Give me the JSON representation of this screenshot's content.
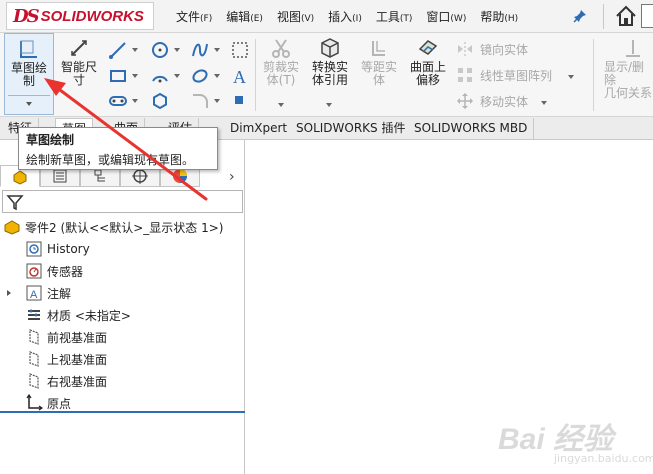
{
  "app": {
    "logo_text": "SOLIDWORKS"
  },
  "menu": [
    {
      "label": "文件",
      "key": "(F)"
    },
    {
      "label": "编辑",
      "key": "(E)"
    },
    {
      "label": "视图",
      "key": "(V)"
    },
    {
      "label": "插入",
      "key": "(I)"
    },
    {
      "label": "工具",
      "key": "(T)"
    },
    {
      "label": "窗口",
      "key": "(W)"
    },
    {
      "label": "帮助",
      "key": "(H)"
    }
  ],
  "ribbon": {
    "sketch_line1": "草图绘",
    "sketch_line2": "制",
    "smart_dim_line1": "智能尺",
    "smart_dim_line2": "寸",
    "trim_line1": "剪裁实",
    "trim_line2": "体(T)",
    "convert_line1": "转换实",
    "convert_line2": "体引用",
    "offset_entity_line1": "等距实",
    "offset_entity_line2": "体",
    "offset_surface_line1": "曲面上",
    "offset_surface_line2": "偏移",
    "mirror": "镜向实体",
    "linear_pattern": "线性草图阵列",
    "move": "移动实体",
    "show_del_line1": "显示/删除",
    "show_del_line2": "几何关系"
  },
  "tabs": [
    "特征",
    "草图",
    "曲面",
    "评估",
    "DimXpert",
    "SOLIDWORKS 插件",
    "SOLIDWORKS MBD"
  ],
  "tooltip": {
    "title": "草图绘制",
    "desc": "绘制新草图，或编辑现有草图。"
  },
  "tree": {
    "root": "零件2 (默认<<默认>_显示状态 1>)",
    "items": [
      "History",
      "传感器",
      "注解",
      "材质 <未指定>",
      "前视基准面",
      "上视基准面",
      "右视基准面",
      "原点"
    ]
  },
  "watermark": {
    "main": "Bai 经验",
    "url": "jingyan.baidu.com"
  },
  "colors": {
    "brand": "#c8102e",
    "accent": "#2e6db4",
    "arrow": "#e8332e"
  }
}
